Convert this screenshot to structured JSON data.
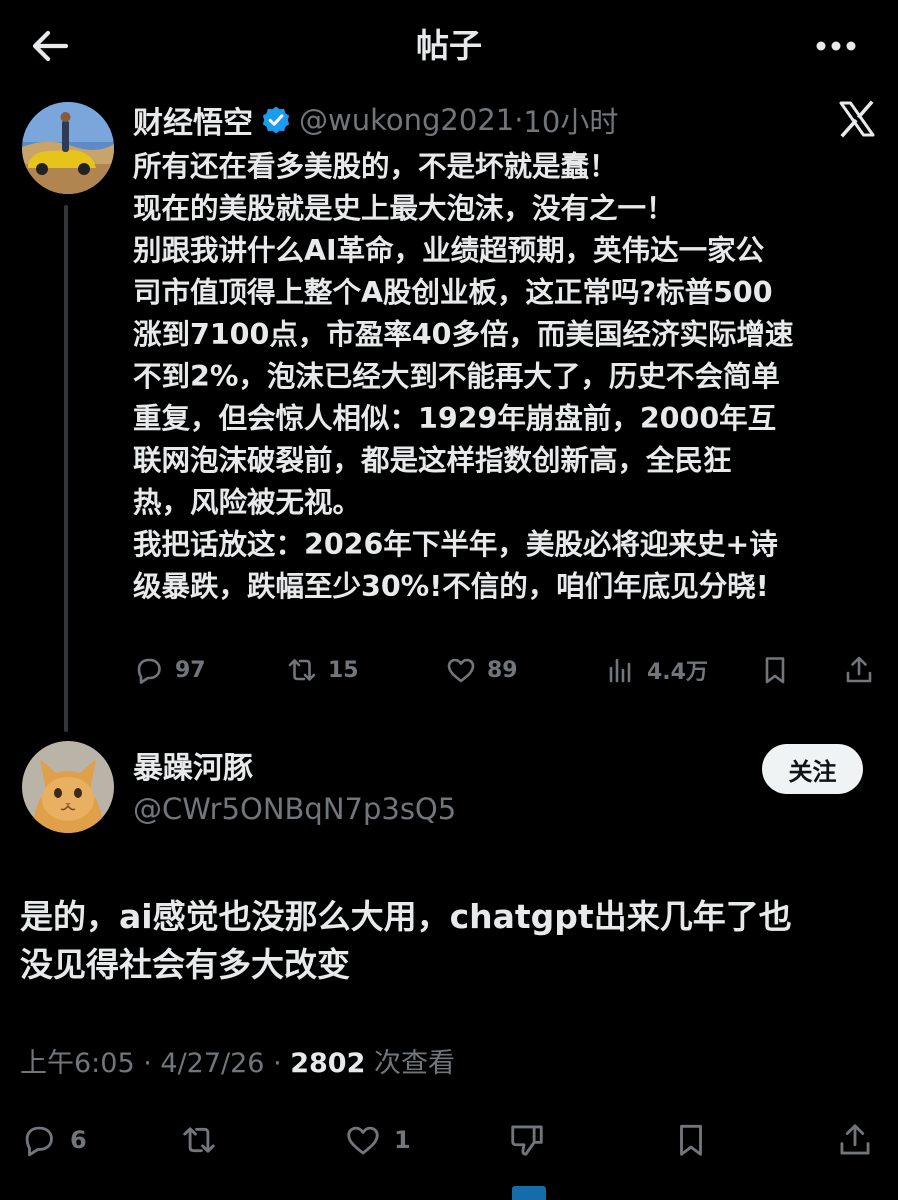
{
  "header": {
    "title": "帖子",
    "back_icon": "back-arrow-icon",
    "more_icon": "more-icon"
  },
  "parent": {
    "name": "财经悟空",
    "handle": "@wukong2021",
    "sep": "·",
    "time": "10小时",
    "lines": [
      "所有还在看多美股的，不是坏就是蠢！",
      "现在的美股就是史上最大泡沫，没有之一！",
      "别跟我讲什么AI革命，业绩超预期，英伟达一家公",
      "司市值顶得上整个A股创业板，这正常吗?标普500",
      "涨到7100点，市盈率40多倍，而美国经济实际增速",
      "不到2%，泡沫已经大到不能再大了，历史不会简单",
      "重复，但会惊人相似：1929年崩盘前，2000年互",
      "联网泡沫破裂前，都是这样指数创新高，全民狂",
      "热，风险被无视。",
      "我把话放这：2026年下半年，美股必将迎来史+诗",
      "级暴跌，跌幅至少30%!不信的，咱们年底见分晓!"
    ],
    "actions": {
      "replies": "97",
      "reposts": "15",
      "likes": "89",
      "views": "4.4万"
    }
  },
  "reply": {
    "name": "暴躁河豚",
    "handle": "@CWr5ONBqN7p3sQ5",
    "follow_label": "关注",
    "lines": [
      "是的，ai感觉也没那么大用，chatgpt出来几年了也",
      "没见得社会有多大改变"
    ],
    "time": "上午6:05",
    "date": "4/27/26",
    "views_count": "2802",
    "views_label": "次查看",
    "actions": {
      "replies": "6",
      "likes": "1"
    }
  },
  "colors": {
    "background": "#000000",
    "text": "#e7e9ea",
    "muted": "#71767b",
    "verified": "#1d9bf0",
    "line": "#333639"
  }
}
